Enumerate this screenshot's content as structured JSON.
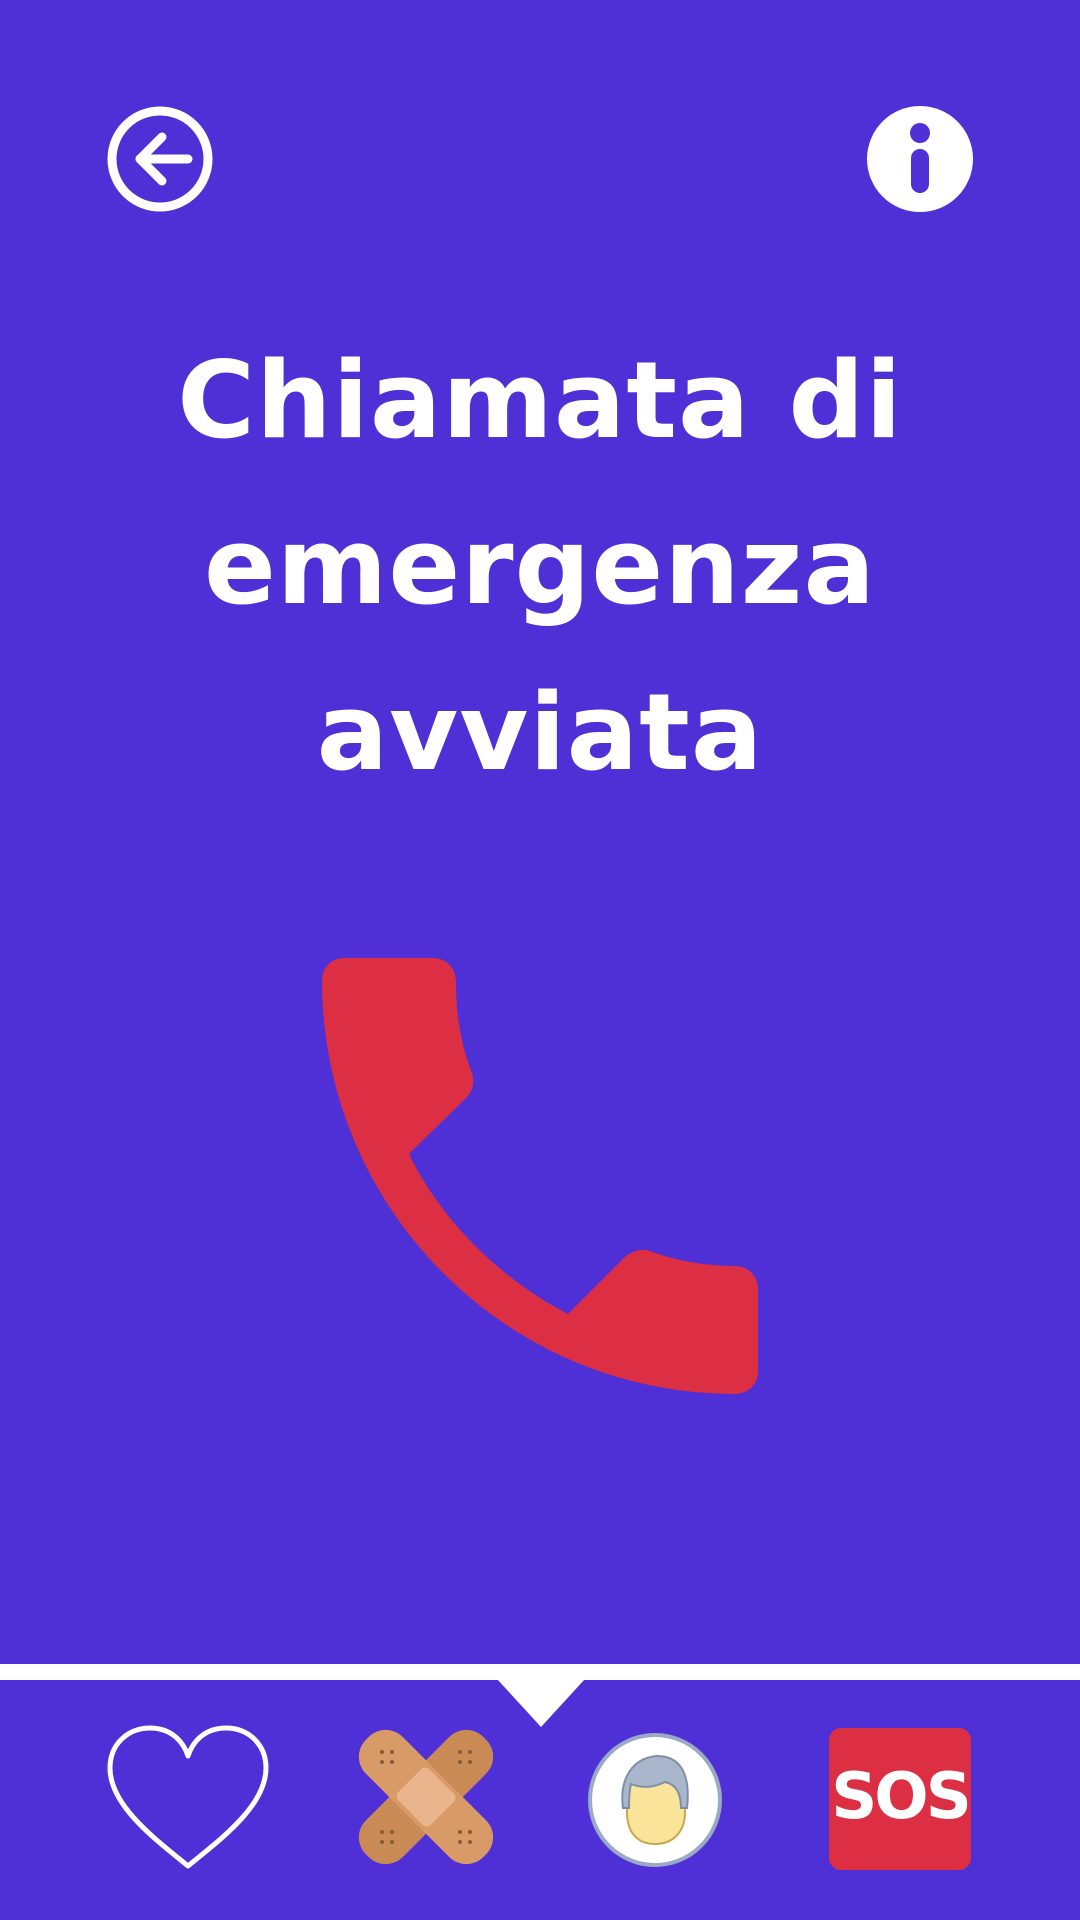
{
  "theme": {
    "background": "#4f2fd6",
    "foreground": "#ffffff",
    "accent_red": "#dc2f43"
  },
  "header": {
    "back_icon": "arrow-left-circle-icon",
    "info_icon": "info-circle-icon"
  },
  "main": {
    "title": "Chiamata di emergenza avviata",
    "status_icon": "phone-handset-icon"
  },
  "bottom_nav": {
    "active_index": 1,
    "items": [
      {
        "icon": "heart-outline-icon"
      },
      {
        "icon": "bandage-icon"
      },
      {
        "icon": "user-avatar-icon"
      },
      {
        "icon": "sos-icon",
        "label": "SOS"
      }
    ]
  }
}
